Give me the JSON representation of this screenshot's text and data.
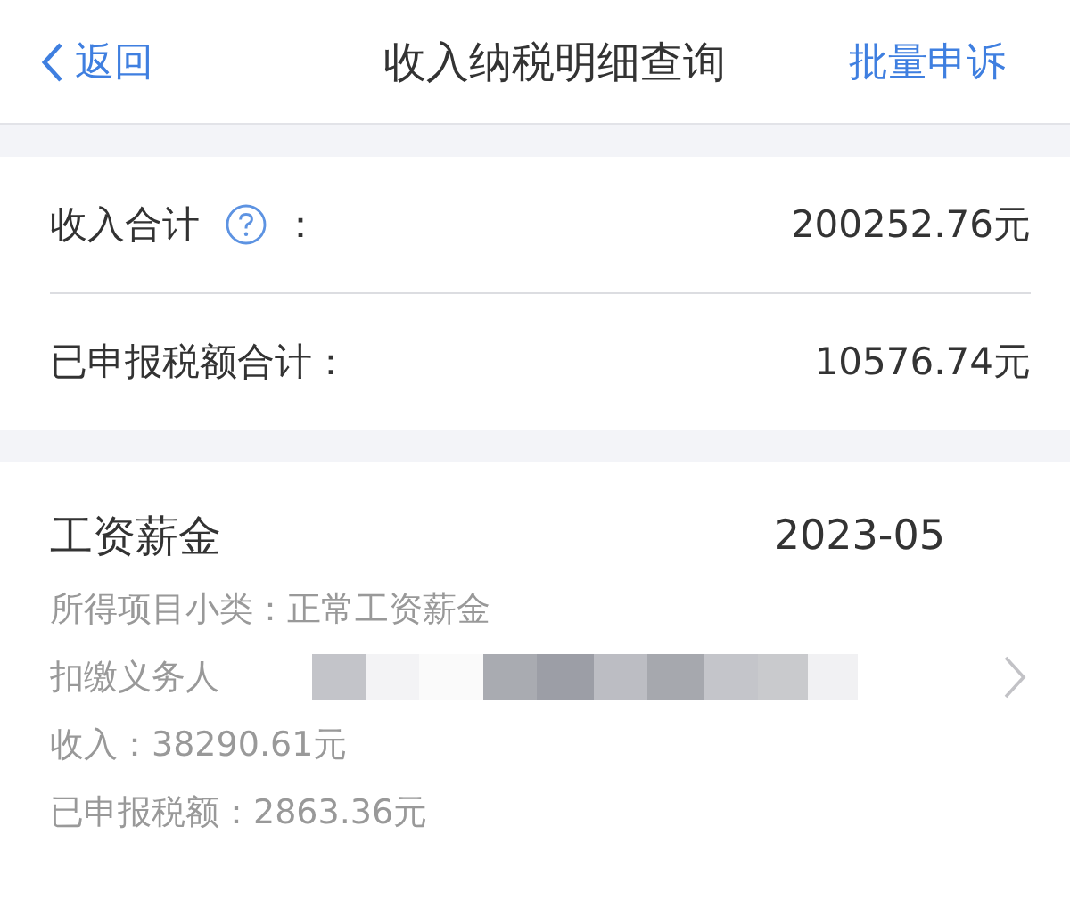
{
  "nav": {
    "back": "返回",
    "title": "收入纳税明细查询",
    "action": "批量申诉"
  },
  "summary": [
    {
      "label": "收入合计",
      "help": true,
      "colon": "：",
      "value": "200252.76元"
    },
    {
      "label": "已申报税额合计：",
      "help": false,
      "value": "10576.74元"
    }
  ],
  "records": [
    {
      "title": "工资薪金",
      "period": "2023-05",
      "details": [
        {
          "kind": "text",
          "text": "所得项目小类：正常工资薪金"
        },
        {
          "kind": "redacted",
          "text": "扣缴义务人"
        },
        {
          "kind": "text",
          "text": "收入：38290.61元"
        },
        {
          "kind": "text",
          "text": "已申报税额：2863.36元"
        }
      ]
    }
  ]
}
